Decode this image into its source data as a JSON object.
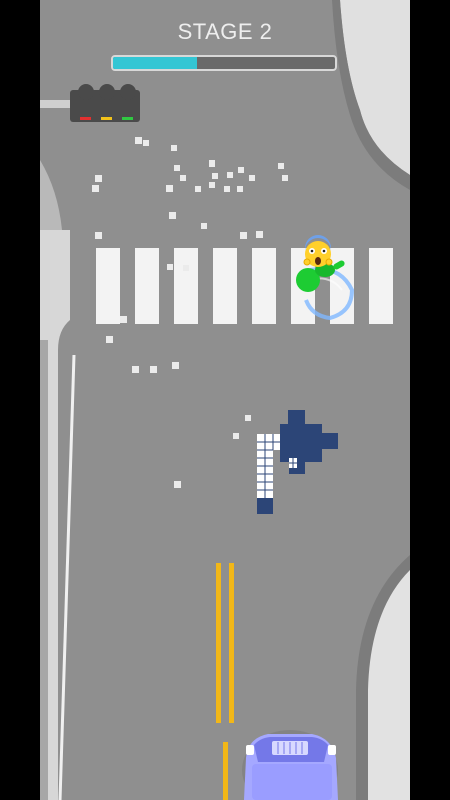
{
  "hud": {
    "stage_label": "STAGE 2",
    "progress": 0.38
  },
  "colors": {
    "road": "#8f8f8f",
    "sidewalk": "#d9d9d9",
    "curb": "#7b7b7b",
    "lane_line": "#f0f0f0",
    "center_line": "#f2b718",
    "crosswalk": "#f3f3f3",
    "progress_fill": "#34c6d4",
    "car": "#a5a8ff",
    "pedestrian": "#1dcc33",
    "obstacle": "#2c4577"
  },
  "icons": {
    "traffic_light": "traffic-light-icon",
    "pedestrian": "scared-face-icon",
    "car": "player-car-icon"
  }
}
